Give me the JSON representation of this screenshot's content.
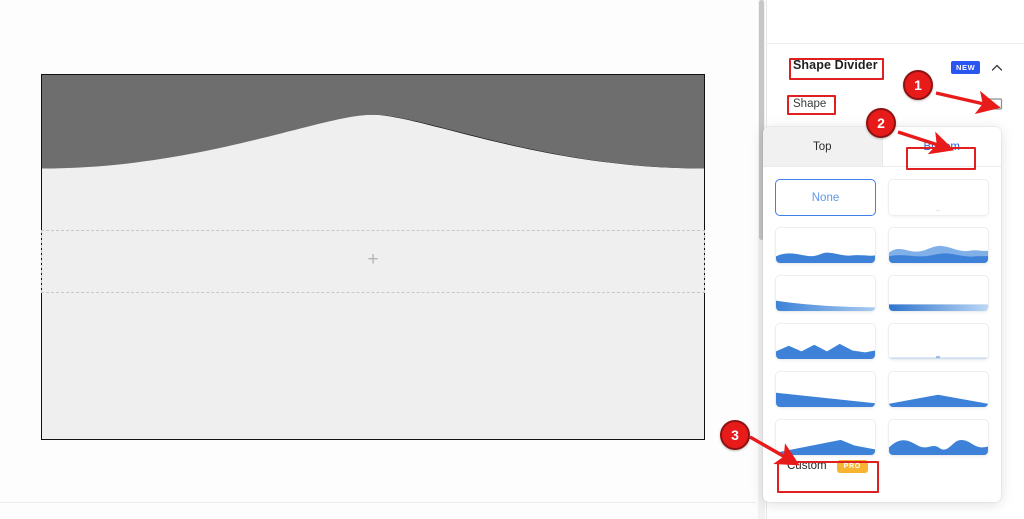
{
  "editor": {
    "canvas": {
      "add_section_glyph": "+",
      "shape_top_color": "#111111",
      "shape_bottom_color": "#6e6e6e",
      "background_color": "#efefef"
    }
  },
  "panel": {
    "section": {
      "title": "Shape Divider",
      "new_badge": "NEW",
      "collapse_icon": "chevron-up-icon"
    },
    "shape_row": {
      "label": "Shape",
      "icon": "shape-divider-icon"
    },
    "popover": {
      "tabs": [
        {
          "label": "Top",
          "active": false
        },
        {
          "label": "Bottom",
          "active": true
        }
      ],
      "items": [
        {
          "label": "None",
          "type": "none",
          "selected": true
        },
        {
          "label": "",
          "type": "blank",
          "selected": false
        },
        {
          "label": "",
          "type": "waves",
          "selected": false
        },
        {
          "label": "",
          "type": "waves-opacity",
          "selected": false
        },
        {
          "label": "",
          "type": "curve-gradient",
          "selected": false
        },
        {
          "label": "",
          "type": "thin-line",
          "selected": false
        },
        {
          "label": "",
          "type": "zigzag",
          "selected": false
        },
        {
          "label": "",
          "type": "flat-thin",
          "selected": false
        },
        {
          "label": "",
          "type": "slope-down",
          "selected": false
        },
        {
          "label": "",
          "type": "triangle-peak",
          "selected": false
        },
        {
          "label": "",
          "type": "slope-up-peak",
          "selected": false
        },
        {
          "label": "",
          "type": "rolling-hills",
          "selected": false
        }
      ],
      "custom": {
        "label": "Custom",
        "pro_badge": "PRO"
      }
    }
  },
  "annotations": {
    "markers": [
      {
        "number": "1",
        "target": "shape-divider-icon"
      },
      {
        "number": "2",
        "target": "bottom-tab"
      },
      {
        "number": "3",
        "target": "custom-row"
      }
    ],
    "highlight_color": "#e02020",
    "highlights": [
      "Shape Divider",
      "Shape",
      "Bottom",
      "Custom"
    ]
  },
  "colors": {
    "accent_blue": "#3c80e8",
    "new_badge_blue": "#2955f0",
    "pro_badge_amber": "#f6b432",
    "annotation_red": "#e81b1b"
  }
}
